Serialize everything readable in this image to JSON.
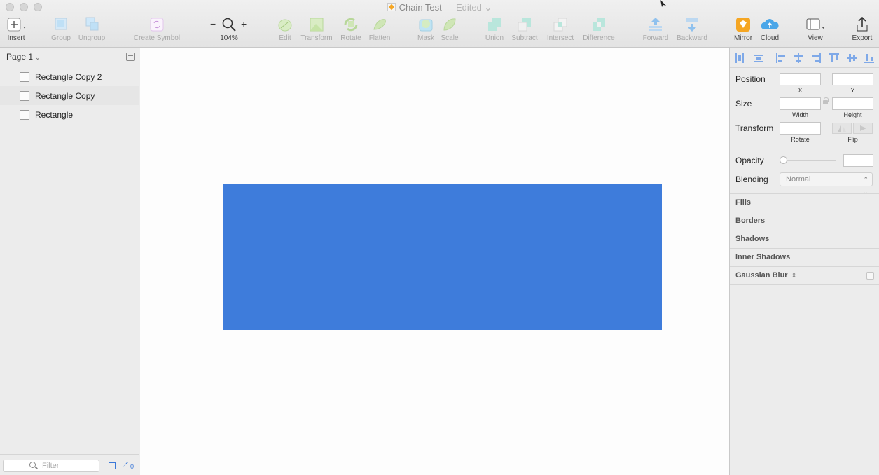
{
  "window": {
    "title": "Chain Test",
    "edited_label": "— Edited",
    "title_chevron": "⌄"
  },
  "toolbar": {
    "insert": "Insert",
    "group": "Group",
    "ungroup": "Ungroup",
    "create_symbol": "Create Symbol",
    "zoom_out": "−",
    "zoom_in": "+",
    "zoom_level": "104%",
    "edit": "Edit",
    "transform": "Transform",
    "rotate": "Rotate",
    "flatten": "Flatten",
    "mask": "Mask",
    "scale": "Scale",
    "union": "Union",
    "subtract": "Subtract",
    "intersect": "Intersect",
    "difference": "Difference",
    "forward": "Forward",
    "backward": "Backward",
    "mirror": "Mirror",
    "cloud": "Cloud",
    "view": "View",
    "export": "Export"
  },
  "sidebar": {
    "page_selector": "Page 1",
    "page_chevron": "⌄",
    "layers": [
      {
        "name": "Rectangle Copy 2"
      },
      {
        "name": "Rectangle Copy"
      },
      {
        "name": "Rectangle"
      }
    ],
    "filter_placeholder": "Filter",
    "count": "0"
  },
  "canvas": {
    "fill_color": "#3E7CDB",
    "background_color": "#FDFDFD"
  },
  "inspector": {
    "position_label": "Position",
    "x_label": "X",
    "y_label": "Y",
    "size_label": "Size",
    "width_label": "Width",
    "height_label": "Height",
    "transform_label": "Transform",
    "rotate_label": "Rotate",
    "flip_label": "Flip",
    "opacity_label": "Opacity",
    "opacity_value": 0,
    "blending_label": "Blending",
    "blending_value": "Normal",
    "sections": [
      "Fills",
      "Borders",
      "Shadows",
      "Inner Shadows"
    ],
    "gaussian_blur": "Gaussian Blur"
  }
}
